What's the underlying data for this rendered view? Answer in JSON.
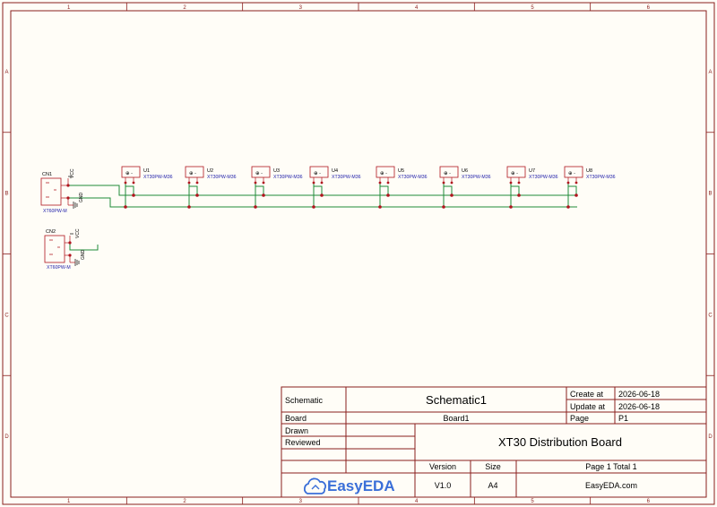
{
  "frame": {
    "columns": [
      "1",
      "2",
      "3",
      "4",
      "5",
      "6"
    ],
    "rows": [
      "A",
      "B",
      "C",
      "D"
    ]
  },
  "connectors": [
    {
      "designator": "CN1",
      "part": "XT60PW-M",
      "nets": [
        "VCC",
        "GND"
      ]
    },
    {
      "designator": "CN2",
      "part": "XT60PW-M",
      "nets": [
        "VCC",
        "GND"
      ]
    }
  ],
  "outputs": [
    {
      "designator": "U1",
      "part": "XT30PW-M36"
    },
    {
      "designator": "U2",
      "part": "XT30PW-M36"
    },
    {
      "designator": "U3",
      "part": "XT30PW-M36"
    },
    {
      "designator": "U4",
      "part": "XT30PW-M36"
    },
    {
      "designator": "U5",
      "part": "XT30PW-M36"
    },
    {
      "designator": "U6",
      "part": "XT30PW-M36"
    },
    {
      "designator": "U7",
      "part": "XT30PW-M36"
    },
    {
      "designator": "U8",
      "part": "XT30PW-M36"
    }
  ],
  "title_block": {
    "schematic_label": "Schematic",
    "schematic_value": "Schematic1",
    "create_label": "Create at",
    "create_value": "2026-06-18",
    "update_label": "Update at",
    "update_value": "2026-06-18",
    "board_label": "Board",
    "board_value": "Board1",
    "page_label": "Page",
    "page_value": "P1",
    "drawn_label": "Drawn",
    "reviewed_label": "Reviewed",
    "title": "XT30 Distribution Board",
    "version_label": "Version",
    "version_value": "V1.0",
    "size_label": "Size",
    "size_value": "A4",
    "page_total": "Page  1  Total  1",
    "website": "EasyEDA.com",
    "logo_text": "EasyEDA"
  },
  "colors": {
    "frame": "#8a1e1e",
    "wire": "#1f8a3a",
    "component": "#b0141e",
    "part_name": "#1a1aa8",
    "logo": "#3a6fd8"
  }
}
